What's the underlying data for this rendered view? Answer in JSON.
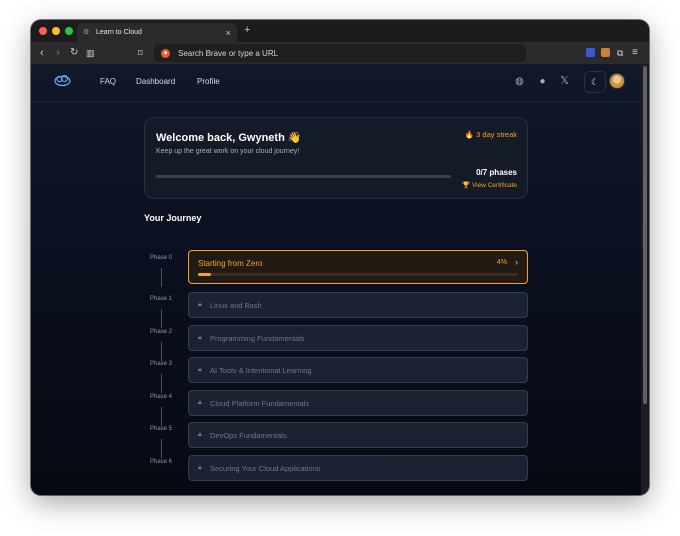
{
  "browser": {
    "tab_title": "Learn to Cloud",
    "new_tab": "+",
    "tab_close": "×",
    "url_placeholder": "Search Brave or type a URL"
  },
  "nav": {
    "links": [
      "FAQ",
      "Dashboard",
      "Profile"
    ],
    "icons": [
      "discord-icon",
      "github-icon",
      "x-icon"
    ],
    "theme_toggle_icon": "moon-icon"
  },
  "welcome": {
    "title": "Welcome back, Gwyneth 👋",
    "subtitle": "Keep up the great work on your cloud journey!",
    "streak": "🔥 3 day streak",
    "phases_done": "0/7 phases",
    "progress_fraction": 0,
    "certificate": "🏆 View Certificate"
  },
  "journey": {
    "heading": "Your Journey",
    "phases": [
      {
        "label": "Phase 0",
        "name": "Starting from Zero",
        "progress": "4%",
        "progress_value": 0.04,
        "active": true
      },
      {
        "label": "Phase 1",
        "name": "Linux and Bash"
      },
      {
        "label": "Phase 2",
        "name": "Programming Fundamentals"
      },
      {
        "label": "Phase 3",
        "name": "AI Tools & Intentional Learning"
      },
      {
        "label": "Phase 4",
        "name": "Cloud Platform Fundamentals"
      },
      {
        "label": "Phase 5",
        "name": "DevOps Fundamentals"
      },
      {
        "label": "Phase 6",
        "name": "Securing Your Cloud Applications"
      }
    ]
  },
  "colors": {
    "accent": "#f5a623",
    "background": "#0b1020",
    "card": "#141a28"
  }
}
